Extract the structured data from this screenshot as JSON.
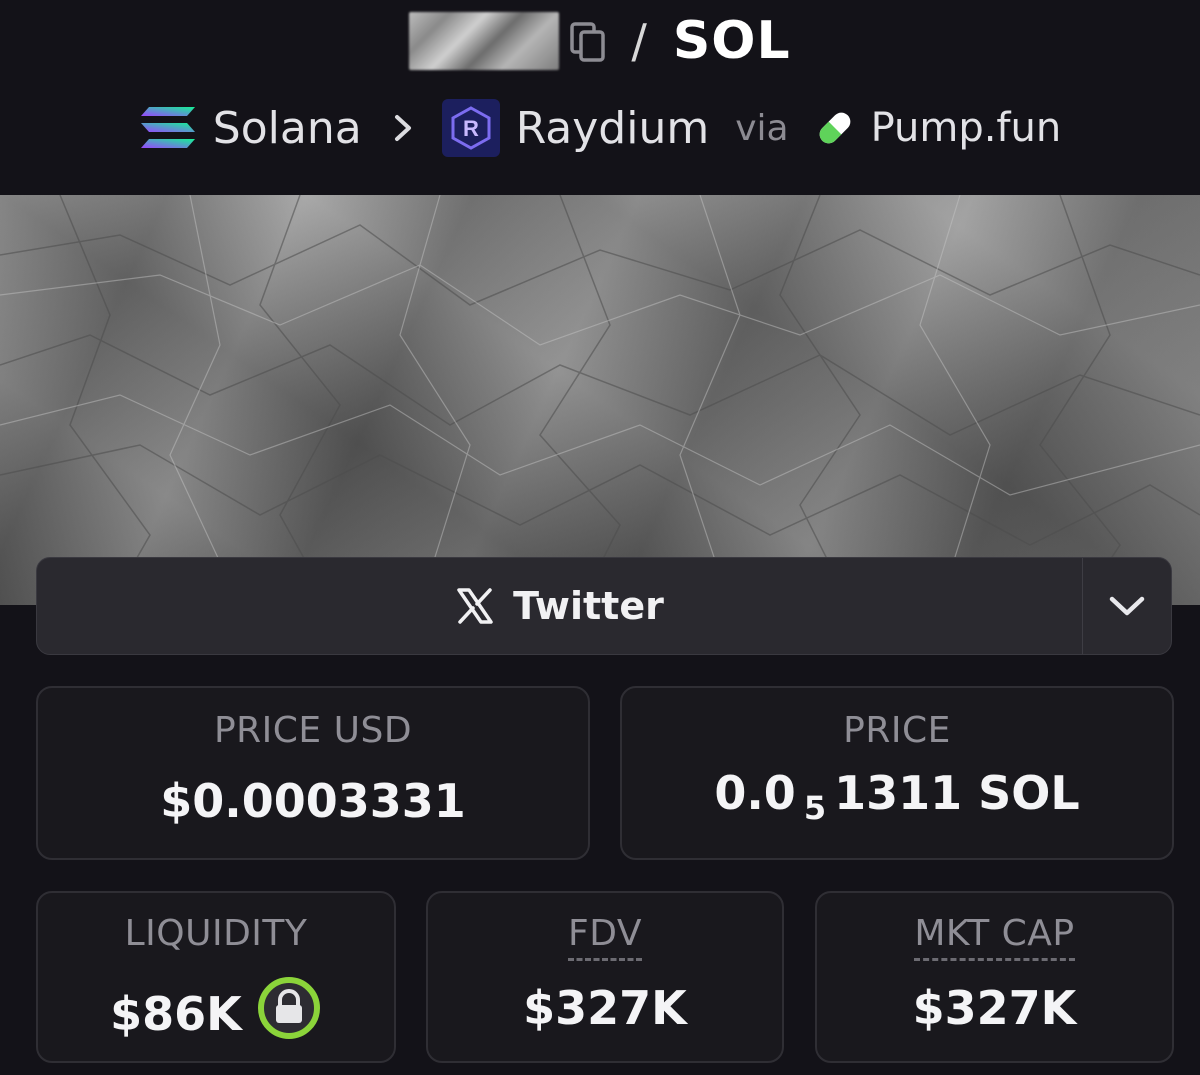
{
  "header": {
    "quote_symbol": "SOL",
    "separator": "/",
    "chain": "Solana",
    "dex": "Raydium",
    "via": "via",
    "launchpad": "Pump.fun",
    "icons": [
      "copy-icon",
      "solana-logo-icon",
      "chevron-right-icon",
      "raydium-logo-icon",
      "pill-icon"
    ]
  },
  "social": {
    "twitter_label": "Twitter",
    "icons": [
      "x-logo-icon",
      "chevron-down-icon"
    ]
  },
  "stats": {
    "price_usd_label": "PRICE USD",
    "price_usd_value": "$0.0003331",
    "price_label": "PRICE",
    "price_prefix": "0.0",
    "price_zeros": "5",
    "price_digits": "1311 SOL",
    "liquidity_label": "LIQUIDITY",
    "liquidity_value": "$86K",
    "fdv_label": "FDV",
    "fdv_value": "$327K",
    "mktcap_label": "MKT CAP",
    "mktcap_value": "$327K"
  },
  "colors": {
    "background": "#131218",
    "card": "#19181d",
    "lock_ring": "#8bd43a",
    "solana_gradient": [
      "#9945FF",
      "#14F195"
    ],
    "raydium_bg": "#1c1f5e",
    "pill_green": "#5fd35a"
  }
}
